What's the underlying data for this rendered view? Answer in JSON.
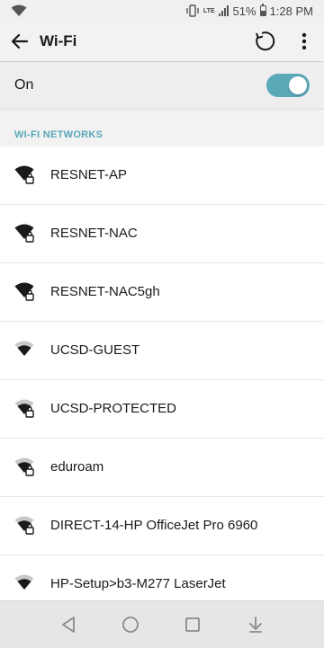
{
  "status_bar": {
    "battery_percent": "51%",
    "time": "1:28 PM",
    "lte_label": "LTE"
  },
  "toolbar": {
    "title": "Wi-Fi"
  },
  "wifi_toggle": {
    "label": "On",
    "state": "on",
    "accent_color": "#5aa9b9"
  },
  "section": {
    "title": "WI-FI NETWORKS"
  },
  "networks": [
    {
      "name": "RESNET-AP",
      "secured": true,
      "strength": "full"
    },
    {
      "name": "RESNET-NAC",
      "secured": true,
      "strength": "full"
    },
    {
      "name": "RESNET-NAC5gh",
      "secured": true,
      "strength": "full"
    },
    {
      "name": "UCSD-GUEST",
      "secured": false,
      "strength": "medium"
    },
    {
      "name": "UCSD-PROTECTED",
      "secured": true,
      "strength": "medium"
    },
    {
      "name": "eduroam",
      "secured": true,
      "strength": "medium"
    },
    {
      "name": "DIRECT-14-HP OfficeJet Pro 6960",
      "secured": true,
      "strength": "medium"
    },
    {
      "name": "HP-Setup>b3-M277 LaserJet",
      "secured": false,
      "strength": "medium"
    }
  ],
  "nav_bar": {
    "icons": [
      "back-icon",
      "home-icon",
      "recents-icon",
      "notification-pull-icon"
    ]
  }
}
